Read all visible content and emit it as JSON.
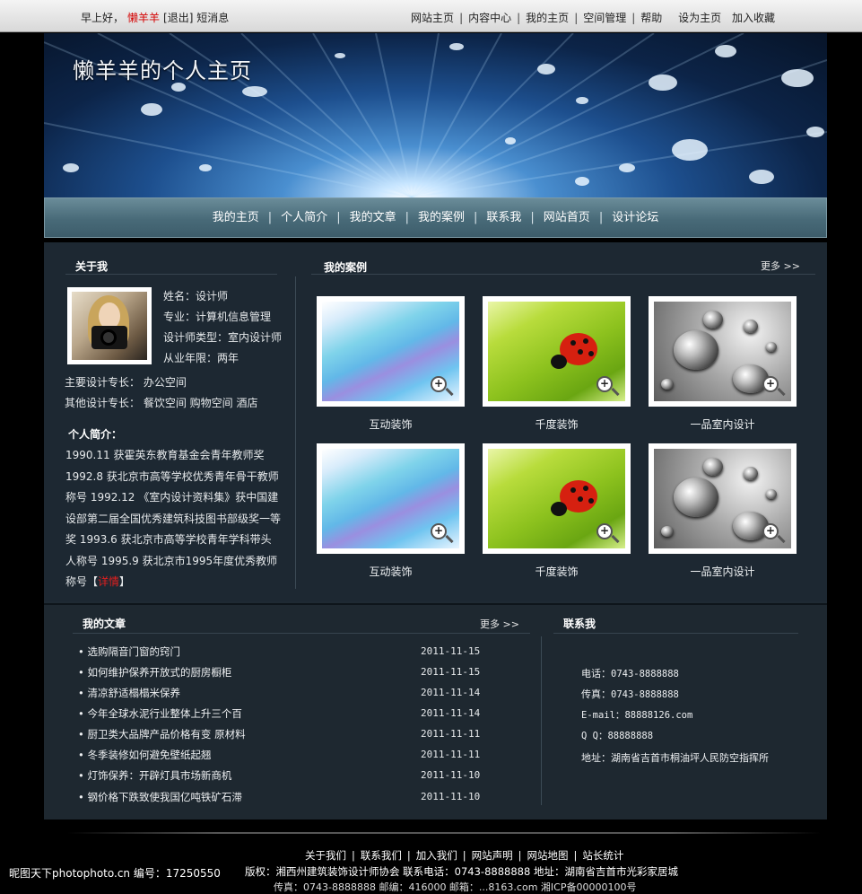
{
  "topbar": {
    "greeting": "早上好，",
    "username": "懒羊羊",
    "logout": "[退出]",
    "messages": "短消息",
    "links": [
      "网站主页",
      "内容中心",
      "我的主页",
      "空间管理",
      "帮助"
    ],
    "set_home": "设为主页",
    "add_favorite": "加入收藏"
  },
  "banner": {
    "title": "懒羊羊的个人主页"
  },
  "nav": {
    "items": [
      "我的主页",
      "个人简介",
      "我的文章",
      "我的案例",
      "联系我",
      "网站首页",
      "设计论坛"
    ]
  },
  "about": {
    "title": "关于我",
    "fields": [
      "姓名：设计师",
      "专业：计算机信息管理",
      "设计师类型：室内设计师",
      "从业年限：两年",
      "主要设计专长：  办公空间",
      "其他设计专长：  餐饮空间   购物空间 酒店"
    ],
    "intro_title": "个人简介：",
    "intro_text": "1990.11 获霍英东教育基金会青年教师奖 1992.8 获北京市高等学校优秀青年骨干教师称号 1992.12 《室内设计资料集》获中国建设部第二届全国优秀建筑科技图书部级奖一等奖 1993.6 获北京市高等学校青年学科带头人称号 1995.9 获北京市1995年度优秀教师称号",
    "detail_open": "【",
    "detail_link": "详情",
    "detail_close": "】"
  },
  "cases": {
    "title": "我的案例",
    "more": "更多 >>",
    "items": [
      {
        "caption": "互动装饰",
        "image": "wave"
      },
      {
        "caption": "千度装饰",
        "image": "leaf"
      },
      {
        "caption": "一品室内设计",
        "image": "drops"
      },
      {
        "caption": "互动装饰",
        "image": "wave"
      },
      {
        "caption": "千度装饰",
        "image": "leaf"
      },
      {
        "caption": "一品室内设计",
        "image": "drops"
      }
    ]
  },
  "articles": {
    "title": "我的文章",
    "more": "更多 >>",
    "items": [
      {
        "title": "• 选购隔音门窗的窍门",
        "date": "2011-11-15"
      },
      {
        "title": "• 如何维护保养开放式的厨房橱柜",
        "date": "2011-11-15"
      },
      {
        "title": "• 清凉舒适榻榻米保养",
        "date": "2011-11-14"
      },
      {
        "title": "• 今年全球水泥行业整体上升三个百",
        "date": "2011-11-14"
      },
      {
        "title": "• 厨卫类大品牌产品价格有变 原材料",
        "date": "2011-11-11"
      },
      {
        "title": "• 冬季装修如何避免壁纸起翘",
        "date": "2011-11-11"
      },
      {
        "title": "• 灯饰保养：开辟灯具市场新商机",
        "date": "2011-11-10"
      },
      {
        "title": "• 钢价格下跌致使我国亿吨铁矿石滞",
        "date": "2011-11-10"
      }
    ]
  },
  "contact": {
    "title": "联系我",
    "phone_label": "电话：",
    "phone": "0743-8888888",
    "fax_label": "传真：",
    "fax": "0743-8888888",
    "email_label": "E-mail：",
    "email": "88888126.com",
    "qq_label": "Q  Q：",
    "qq": "88888888",
    "address_label": "地址：",
    "address": "湖南省吉首市桐油坪人民防空指挥所"
  },
  "footer": {
    "links": [
      "关于我们",
      "联系我们",
      "加入我们",
      "网站声明",
      "网站地图",
      "站长统计"
    ],
    "copyright": "版权：湘西州建筑装饰设计师协会     联系电话：0743-8888888     地址：湖南省吉首市光彩家居城",
    "cutoff_line": "传真：0743-8888888     邮编：416000     邮箱：...8163.com     湘ICP备00000100号"
  },
  "watermark": "昵图天下photophoto.cn  编号：17250550"
}
